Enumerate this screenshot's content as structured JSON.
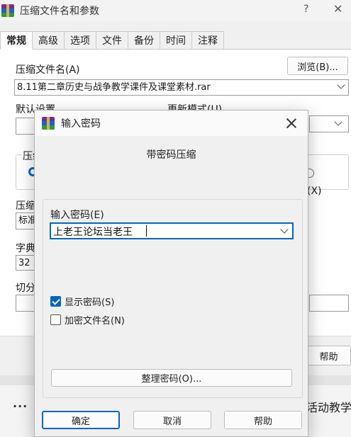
{
  "background_window": {
    "title": "压缩文件名和参数",
    "help_glyph": "?",
    "close_glyph": "✕",
    "tabs": [
      "常规",
      "高级",
      "选项",
      "文件",
      "备份",
      "时间",
      "注释"
    ],
    "archive_name_label": "压缩文件名(A)",
    "browse_label": "浏览(B)...",
    "archive_name_value": "8.11第二章历史与战争教学课件及课堂素材.rar",
    "default_profile_label": "默认设置",
    "update_mode_label": "更新模式(U)",
    "archive_format_label": "压缩",
    "radio_partial_label": "(X)",
    "compression_method_label": "压缩",
    "compression_method_value": "标准",
    "dictionary_label": "字典",
    "dictionary_value": "32",
    "split_label": "切分",
    "help_label": "帮助",
    "overflow_dots": "...",
    "behind_text": "活动教学"
  },
  "dialog": {
    "title": "输入密码",
    "heading": "带密码压缩",
    "password_label": "输入密码(E)",
    "password_value": "上老王论坛当老王",
    "show_password_label": "显示密码(S)",
    "show_password_checked": true,
    "encrypt_filenames_label": "加密文件名(N)",
    "encrypt_filenames_checked": false,
    "organize_label": "整理密码(O)...",
    "ok_label": "确定",
    "cancel_label": "取消",
    "help_label": "帮助"
  },
  "colors": {
    "accent": "#0067c0"
  }
}
